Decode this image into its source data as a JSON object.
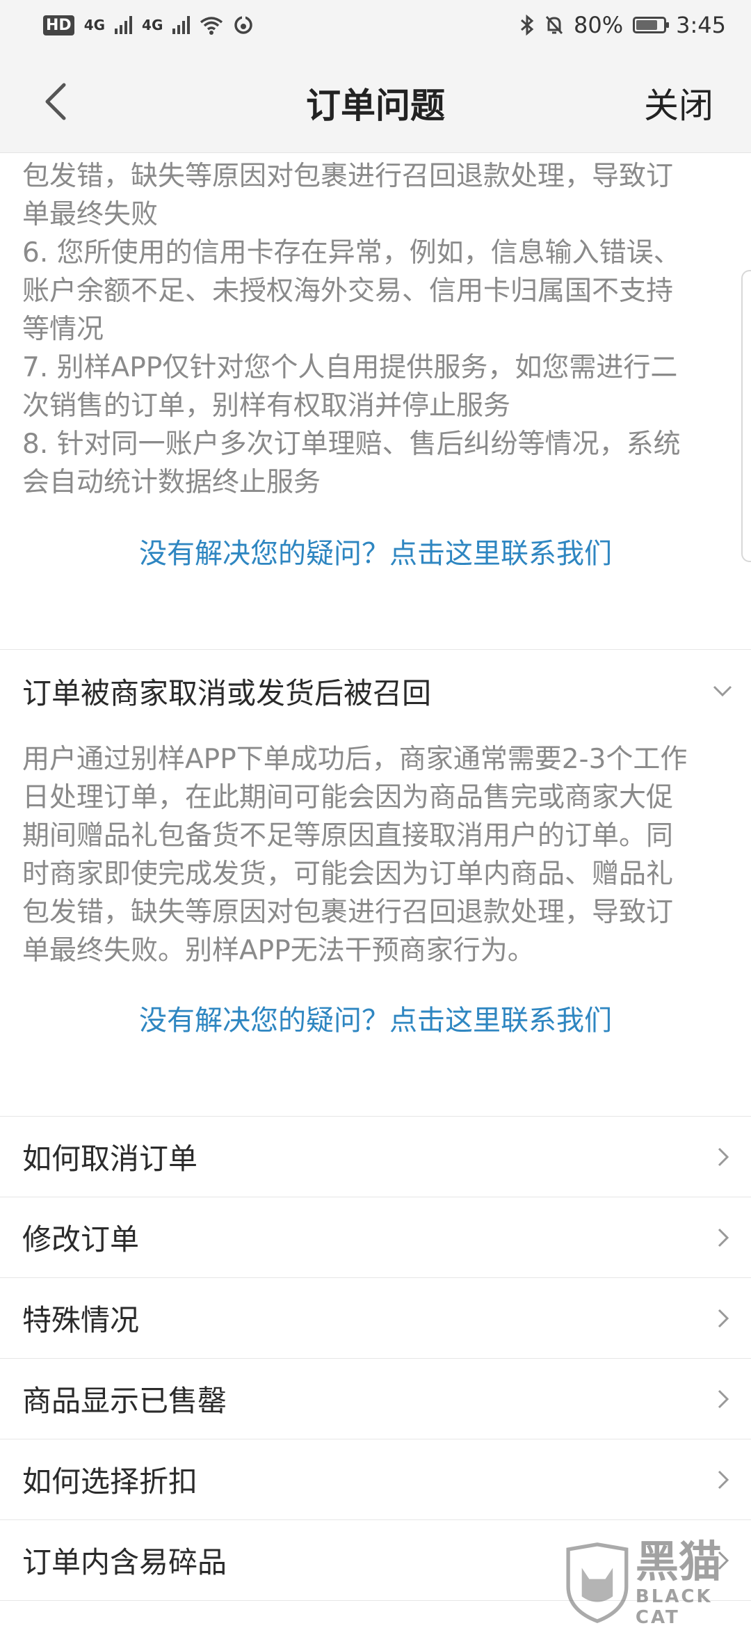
{
  "status_bar": {
    "hd": "HD",
    "net1": "4G",
    "net2": "4G",
    "battery_percent": "80%",
    "battery_level": 0.8,
    "time": "3:45",
    "icons": [
      "signal-icon",
      "wifi-icon",
      "hotspot-icon",
      "bluetooth-icon",
      "mute-bell-icon",
      "battery-icon"
    ]
  },
  "nav": {
    "title": "订单问题",
    "close_label": "关闭"
  },
  "section1": {
    "lines": [
      "包发错，缺失等原因对包裹进行召回退款处理，导致订",
      "单最终失败",
      "6. 您所使用的信用卡存在异常，例如，信息输入错误、",
      "账户余额不足、未授权海外交易、信用卡归属国不支持",
      "等情况",
      "7. 别样APP仅针对您个人自用提供服务，如您需进行二",
      "次销售的订单，别样有权取消并停止服务",
      "8. 针对同一账户多次订单理赔、售后纠纷等情况，系统",
      "会自动统计数据终止服务"
    ],
    "contact_link": "没有解决您的疑问？点击这里联系我们"
  },
  "section2": {
    "title": "订单被商家取消或发货后被召回",
    "lines": [
      "用户通过别样APP下单成功后，商家通常需要2-3个工作",
      "日处理订单，在此期间可能会因为商品售完或商家大促",
      "期间赠品礼包备货不足等原因直接取消用户的订单。同",
      "时商家即使完成发货，可能会因为订单内商品、赠品礼",
      "包发错，缺失等原因对包裹进行召回退款处理，导致订",
      "单最终失败。别样APP无法干预商家行为。"
    ],
    "contact_link": "没有解决您的疑问？点击这里联系我们"
  },
  "list_items": [
    "如何取消订单",
    "修改订单",
    "特殊情况",
    "商品显示已售罄",
    "如何选择折扣",
    "订单内含易碎品"
  ],
  "watermark": {
    "cn": "黑猫",
    "en": "BLACK CAT"
  },
  "colors": {
    "link": "#2e86c1",
    "body_text": "#8a8a8a",
    "bar_bg": "#f4f4f4"
  }
}
